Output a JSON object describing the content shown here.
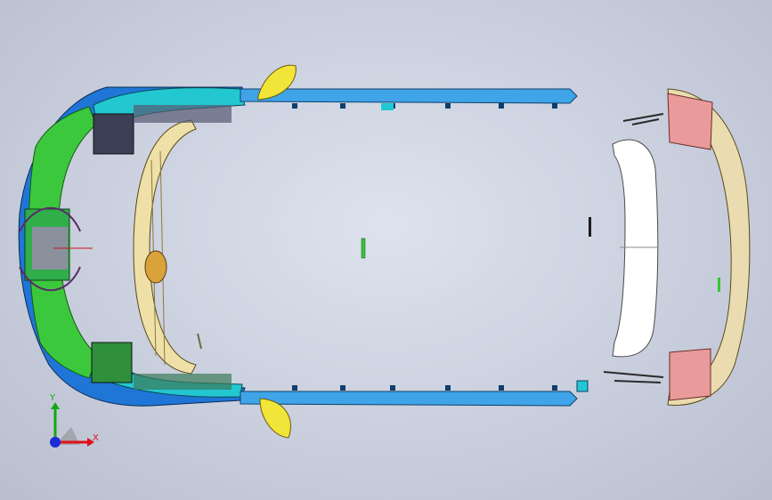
{
  "triad": {
    "x_label": "X",
    "y_label": "Y",
    "x_color": "#e0101a",
    "y_color": "#13a813",
    "z_color": "#1b2bd6"
  },
  "colors": {
    "background": "#c9cfdd",
    "cyan_panel": "#1fc9d0",
    "green_panel": "#39c53a",
    "blue_panel": "#1f76d6",
    "yellow_part": "#f0e03a",
    "tan_part": "#eadcb0",
    "rail_blue": "#3fa4e8",
    "pink_part": "#e99a9a",
    "white_part": "#ffffff"
  },
  "icons": [
    "reference-triad-icon"
  ]
}
